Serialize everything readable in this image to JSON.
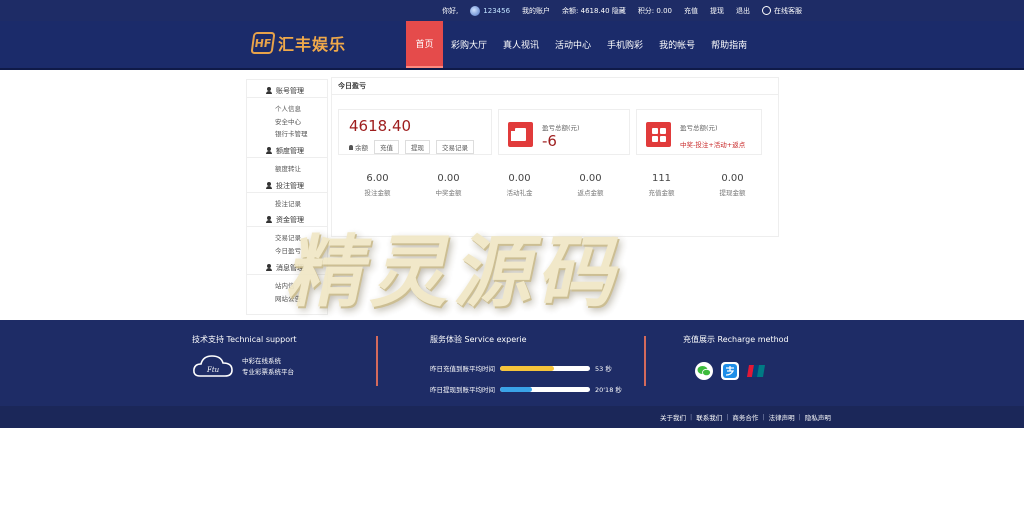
{
  "topbar": {
    "greeting": "你好,",
    "username": "123456",
    "my_account": "我的账户",
    "balance_label": "余额:",
    "balance_value": "4618.40",
    "balance_hide": "隐藏",
    "points_label": "积分:",
    "points_value": "0.00",
    "recharge": "充值",
    "withdraw": "提现",
    "logout": "退出",
    "customer_service": "在线客服"
  },
  "brand": {
    "logo_mark": "HF",
    "name": "汇丰娱乐"
  },
  "nav": {
    "items": [
      {
        "label": "首页"
      },
      {
        "label": "彩购大厅"
      },
      {
        "label": "真人视讯"
      },
      {
        "label": "活动中心"
      },
      {
        "label": "手机购彩"
      },
      {
        "label": "我的帐号"
      },
      {
        "label": "帮助指南"
      }
    ]
  },
  "sidebar": {
    "groups": [
      {
        "title": "账号管理",
        "items": [
          "个人信息",
          "安全中心",
          "银行卡管理"
        ]
      },
      {
        "title": "额度管理",
        "items": [
          "额度转让"
        ]
      },
      {
        "title": "投注管理",
        "items": [
          "投注记录"
        ]
      },
      {
        "title": "资金管理",
        "items": [
          "交易记录",
          "今日盈亏"
        ]
      },
      {
        "title": "消息管理",
        "items": [
          "站内信",
          "网站公告"
        ]
      }
    ]
  },
  "panel": {
    "title": "今日盈亏",
    "balance_value": "4618.40",
    "balance_label": "余额",
    "btn_recharge": "充值",
    "btn_withdraw": "提现",
    "btn_records": "交易记录",
    "profit_label": "盈亏总额(元)",
    "profit_value": "-6",
    "formula_label": "盈亏总额(元)",
    "formula_text": "中奖-投注+活动+返点",
    "stats": [
      {
        "value": "6.00",
        "label": "投注金额"
      },
      {
        "value": "0.00",
        "label": "中奖金额"
      },
      {
        "value": "0.00",
        "label": "活动礼金"
      },
      {
        "value": "0.00",
        "label": "返点金额"
      },
      {
        "value": "111",
        "label": "充值金额"
      },
      {
        "value": "0.00",
        "label": "提现金额"
      }
    ]
  },
  "watermark": "精灵源码",
  "footer": {
    "support_title": "技术支持 Technical support",
    "support_line1": "中彩在线系统",
    "support_line2": "专业彩票系统平台",
    "service_title": "服务体验 Service experie",
    "deposit_label": "昨日充值到账平均时间",
    "deposit_value": "53 秒",
    "deposit_progress": 0.6,
    "withdraw_label": "昨日提现到账平均时间",
    "withdraw_value": "20'18 秒",
    "withdraw_progress": 0.35,
    "recharge_title": "充值展示 Recharge method",
    "accent_yellow": "#f5c33b",
    "accent_blue": "#3aa3e8"
  },
  "bottom_links": [
    "关于我们",
    "联系我们",
    "商务合作",
    "法律声明",
    "隐私声明"
  ]
}
